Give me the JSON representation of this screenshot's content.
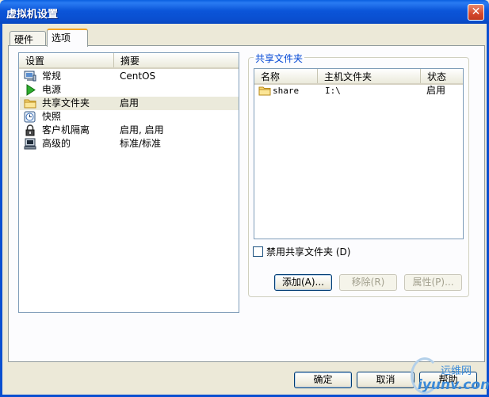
{
  "window": {
    "title": "虚拟机设置",
    "close_glyph": "✕"
  },
  "tabs": [
    {
      "label": "硬件",
      "active": false
    },
    {
      "label": "选项",
      "active": true
    }
  ],
  "settings_list": {
    "headers": {
      "setting": "设置",
      "summary": "摘要"
    },
    "rows": [
      {
        "label": "常规",
        "value": "CentOS",
        "icon": "general-monitor-icon",
        "selected": false
      },
      {
        "label": "电源",
        "value": "",
        "icon": "power-play-icon",
        "selected": false
      },
      {
        "label": "共享文件夹",
        "value": "启用",
        "icon": "folder-icon",
        "selected": true
      },
      {
        "label": "快照",
        "value": "",
        "icon": "snapshot-clock-icon",
        "selected": false
      },
      {
        "label": "客户机隔离",
        "value": "启用, 启用",
        "icon": "lock-icon",
        "selected": false
      },
      {
        "label": "高级的",
        "value": "标准/标准",
        "icon": "advanced-computer-icon",
        "selected": false
      }
    ]
  },
  "shared_folders": {
    "group_title": "共享文件夹",
    "headers": {
      "name": "名称",
      "host_folder": "主机文件夹",
      "status": "状态"
    },
    "rows": [
      {
        "name": "share",
        "host_folder": "I:\\",
        "status": "启用"
      }
    ],
    "disable_checkbox": {
      "label": "禁用共享文件夹 (D)",
      "checked": false
    },
    "buttons": {
      "add": "添加(A)...",
      "remove": "移除(R)",
      "properties": "属性(P)..."
    }
  },
  "footer_buttons": {
    "ok": "确定",
    "cancel": "取消",
    "help": "帮助"
  },
  "watermark": {
    "top": "运维网",
    "bottom": "iyunv.com"
  },
  "colors": {
    "titlebar": "#0a4fd0",
    "accent_tab": "#f5a623",
    "group_title": "#0046d5",
    "selection": "#ebeadb"
  }
}
